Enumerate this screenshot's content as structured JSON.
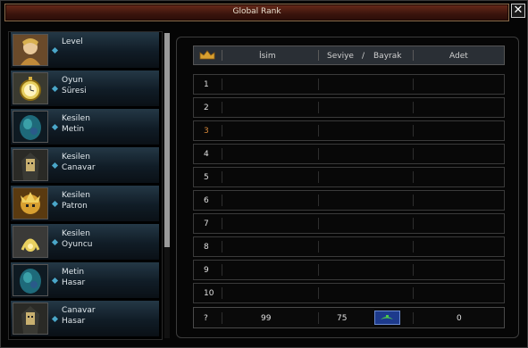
{
  "window": {
    "title": "Global Rank",
    "close_label": "✕"
  },
  "categories": [
    {
      "label": "Level",
      "icon": "warrior-portrait-icon"
    },
    {
      "label": "Oyun\nSüresi",
      "icon": "pocket-watch-icon"
    },
    {
      "label": "Kesilen\nMetin",
      "icon": "metin-stone-icon"
    },
    {
      "label": "Kesilen\nCanavar",
      "icon": "monster-icon"
    },
    {
      "label": "Kesilen\nPatron",
      "icon": "boss-icon"
    },
    {
      "label": "Kesilen\nOyuncu",
      "icon": "player-icon"
    },
    {
      "label": "Metin\nHasar",
      "icon": "metin-stone-icon"
    },
    {
      "label": "Canavar\nHasar",
      "icon": "monster-icon"
    }
  ],
  "scroll": {
    "position": 0
  },
  "table": {
    "headers": {
      "name": "İsim",
      "level": "Seviye",
      "slash": "/",
      "flag": "Bayrak",
      "count": "Adet"
    },
    "ranks": [
      "1",
      "2",
      "3",
      "4",
      "5",
      "6",
      "7",
      "8",
      "9",
      "10"
    ]
  },
  "my_rank": {
    "rank": "?",
    "name": "99",
    "level": "75",
    "count": "0"
  },
  "colors": {
    "title_bar": "#4a1a10",
    "accent_blue": "#4aa6c8",
    "bronze": "#d9893a"
  }
}
